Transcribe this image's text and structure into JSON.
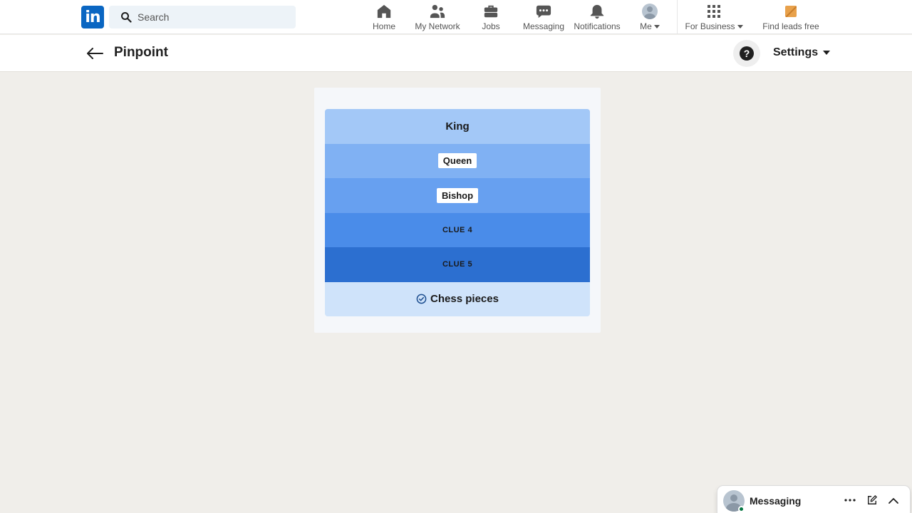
{
  "nav": {
    "logo": "in",
    "search_placeholder": "Search",
    "items": [
      {
        "label": "Home",
        "icon": "home-icon"
      },
      {
        "label": "My Network",
        "icon": "network-icon"
      },
      {
        "label": "Jobs",
        "icon": "briefcase-icon"
      },
      {
        "label": "Messaging",
        "icon": "chat-icon"
      },
      {
        "label": "Notifications",
        "icon": "bell-icon"
      },
      {
        "label": "Me",
        "icon": "avatar"
      },
      {
        "label": "For Business",
        "icon": "grid-icon"
      },
      {
        "label": "Find leads free",
        "icon": "leads-icon"
      }
    ]
  },
  "header": {
    "title": "Pinpoint",
    "help_icon_text": "?",
    "settings_label": "Settings"
  },
  "game": {
    "clues": [
      {
        "text": "King",
        "state": "revealed-plain"
      },
      {
        "text": "Queen",
        "state": "revealed-chip"
      },
      {
        "text": "Bishop",
        "state": "revealed-chip"
      },
      {
        "text": "CLUE 4",
        "state": "hidden"
      },
      {
        "text": "CLUE 5",
        "state": "hidden"
      }
    ],
    "answer": "Chess pieces",
    "colors": {
      "row1": "#a3c8f7",
      "row2": "#80b1f3",
      "row3": "#67a0f0",
      "row4": "#4a8ce9",
      "row5": "#2c6fd0",
      "answer": "#cfe3fa"
    }
  },
  "messaging": {
    "title": "Messaging"
  },
  "colors": {
    "brand": "#0a66c2",
    "background": "#f0eeea"
  }
}
